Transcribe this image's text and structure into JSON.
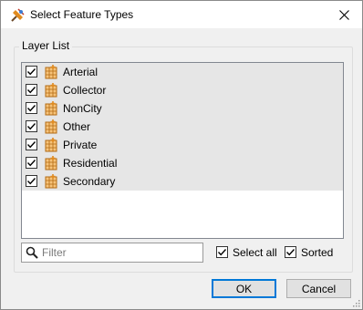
{
  "window": {
    "title": "Select Feature Types",
    "icons": {
      "app": "fme-workbench-icon",
      "close": "close-icon"
    }
  },
  "group": {
    "legend": "Layer List",
    "items": [
      {
        "label": "Arterial",
        "checked": true,
        "icon": "feature-layer-icon"
      },
      {
        "label": "Collector",
        "checked": true,
        "icon": "feature-layer-icon"
      },
      {
        "label": "NonCity",
        "checked": true,
        "icon": "feature-layer-icon"
      },
      {
        "label": "Other",
        "checked": true,
        "icon": "feature-layer-icon"
      },
      {
        "label": "Private",
        "checked": true,
        "icon": "feature-layer-icon"
      },
      {
        "label": "Residential",
        "checked": true,
        "icon": "feature-layer-icon"
      },
      {
        "label": "Secondary",
        "checked": true,
        "icon": "feature-layer-icon"
      }
    ],
    "filter": {
      "placeholder": "Filter",
      "value": ""
    },
    "select_all": {
      "label": "Select all",
      "checked": true
    },
    "sorted": {
      "label": "Sorted",
      "checked": true
    }
  },
  "buttons": {
    "ok": "OK",
    "cancel": "Cancel"
  },
  "colors": {
    "accent": "#0078d7",
    "item_bg": "#e6e6e6",
    "icon_orange": "#e08a1e"
  }
}
